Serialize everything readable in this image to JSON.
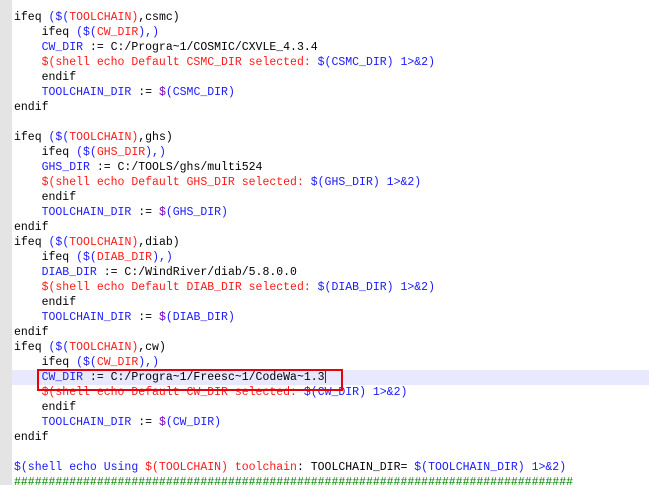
{
  "colors": {
    "k": "#000000",
    "b": "#1a1aff",
    "p": "#7a00c0",
    "r": "#ff1a1a",
    "g": "#008000"
  },
  "current_line": 24,
  "lines": [
    [
      [
        "ifeq ",
        "k"
      ],
      [
        "($(",
        "b"
      ],
      [
        "TOOLCHAIN)",
        "r"
      ],
      [
        ",csmc)",
        "k"
      ]
    ],
    [
      [
        "    ifeq ",
        "k"
      ],
      [
        "($(",
        "b"
      ],
      [
        "CW_DIR",
        "r"
      ],
      [
        "),)",
        "b"
      ]
    ],
    [
      [
        "    CW_DIR",
        "b"
      ],
      [
        " := C:/Progra~1/COSMIC/CXVLE_4.3.4",
        "k"
      ]
    ],
    [
      [
        "    $(shell echo Default CSMC_DIR selected: ",
        "r"
      ],
      [
        "$(CSMC_DIR) 1>&2)",
        "b"
      ]
    ],
    [
      [
        "    endif",
        "k"
      ]
    ],
    [
      [
        "    TOOLCHAIN_DIR",
        "b"
      ],
      [
        " := ",
        "k"
      ],
      [
        "$",
        "p"
      ],
      [
        "(CSMC_DIR)",
        "b"
      ]
    ],
    [
      [
        "endif",
        "k"
      ]
    ],
    [
      [
        "",
        "k"
      ]
    ],
    [
      [
        "ifeq ",
        "k"
      ],
      [
        "($(",
        "b"
      ],
      [
        "TOOLCHAIN)",
        "r"
      ],
      [
        ",ghs)",
        "k"
      ]
    ],
    [
      [
        "    ifeq ",
        "k"
      ],
      [
        "($(",
        "b"
      ],
      [
        "GHS_DIR",
        "r"
      ],
      [
        "),)",
        "b"
      ]
    ],
    [
      [
        "    GHS_DIR",
        "b"
      ],
      [
        " := C:/TOOLS/ghs/multi524",
        "k"
      ]
    ],
    [
      [
        "    $(shell echo Default GHS_DIR selected: ",
        "r"
      ],
      [
        "$(GHS_DIR) 1>&2)",
        "b"
      ]
    ],
    [
      [
        "    endif",
        "k"
      ]
    ],
    [
      [
        "    TOOLCHAIN_DIR",
        "b"
      ],
      [
        " := ",
        "k"
      ],
      [
        "$",
        "p"
      ],
      [
        "(GHS_DIR)",
        "b"
      ]
    ],
    [
      [
        "endif",
        "k"
      ]
    ],
    [
      [
        "ifeq ",
        "k"
      ],
      [
        "($(",
        "b"
      ],
      [
        "TOOLCHAIN)",
        "r"
      ],
      [
        ",diab)",
        "k"
      ]
    ],
    [
      [
        "    ifeq ",
        "k"
      ],
      [
        "($(",
        "b"
      ],
      [
        "DIAB_DIR",
        "r"
      ],
      [
        "),)",
        "b"
      ]
    ],
    [
      [
        "    DIAB_DIR",
        "b"
      ],
      [
        " := C:/WindRiver/diab/5.8.0.0",
        "k"
      ]
    ],
    [
      [
        "    $(shell echo Default DIAB_DIR selected: ",
        "r"
      ],
      [
        "$(DIAB_DIR) 1>&2)",
        "b"
      ]
    ],
    [
      [
        "    endif",
        "k"
      ]
    ],
    [
      [
        "    TOOLCHAIN_DIR",
        "b"
      ],
      [
        " := ",
        "k"
      ],
      [
        "$",
        "p"
      ],
      [
        "(DIAB_DIR)",
        "b"
      ]
    ],
    [
      [
        "endif",
        "k"
      ]
    ],
    [
      [
        "ifeq ",
        "k"
      ],
      [
        "($(",
        "b"
      ],
      [
        "TOOLCHAIN)",
        "r"
      ],
      [
        ",cw)",
        "k"
      ]
    ],
    [
      [
        "    ifeq ",
        "k"
      ],
      [
        "($(",
        "b"
      ],
      [
        "CW_DIR",
        "r"
      ],
      [
        "),)",
        "b"
      ]
    ],
    [
      [
        "    CW_DIR",
        "b"
      ],
      [
        " := C:/Progra~1/Freesc~1/CodeWa~1.3",
        "k"
      ]
    ],
    [
      [
        "    $(shell echo Default CW_DIR selected: ",
        "r"
      ],
      [
        "$(CW_DIR) 1>&2)",
        "b"
      ]
    ],
    [
      [
        "    endif",
        "k"
      ]
    ],
    [
      [
        "    TOOLCHAIN_DIR",
        "b"
      ],
      [
        " := ",
        "k"
      ],
      [
        "$",
        "p"
      ],
      [
        "(CW_DIR)",
        "b"
      ]
    ],
    [
      [
        "endif",
        "k"
      ]
    ],
    [
      [
        "",
        "k"
      ]
    ],
    [
      [
        "$(shell echo Using ",
        "b"
      ],
      [
        "$(TOOLCHAIN) toolchain",
        "r"
      ],
      [
        ": TOOLCHAIN_DIR= ",
        "k"
      ],
      [
        "$(TOOLCHAIN_DIR) 1>&2)",
        "b"
      ]
    ],
    [
      [
        "#################################################################################",
        "g"
      ]
    ]
  ]
}
